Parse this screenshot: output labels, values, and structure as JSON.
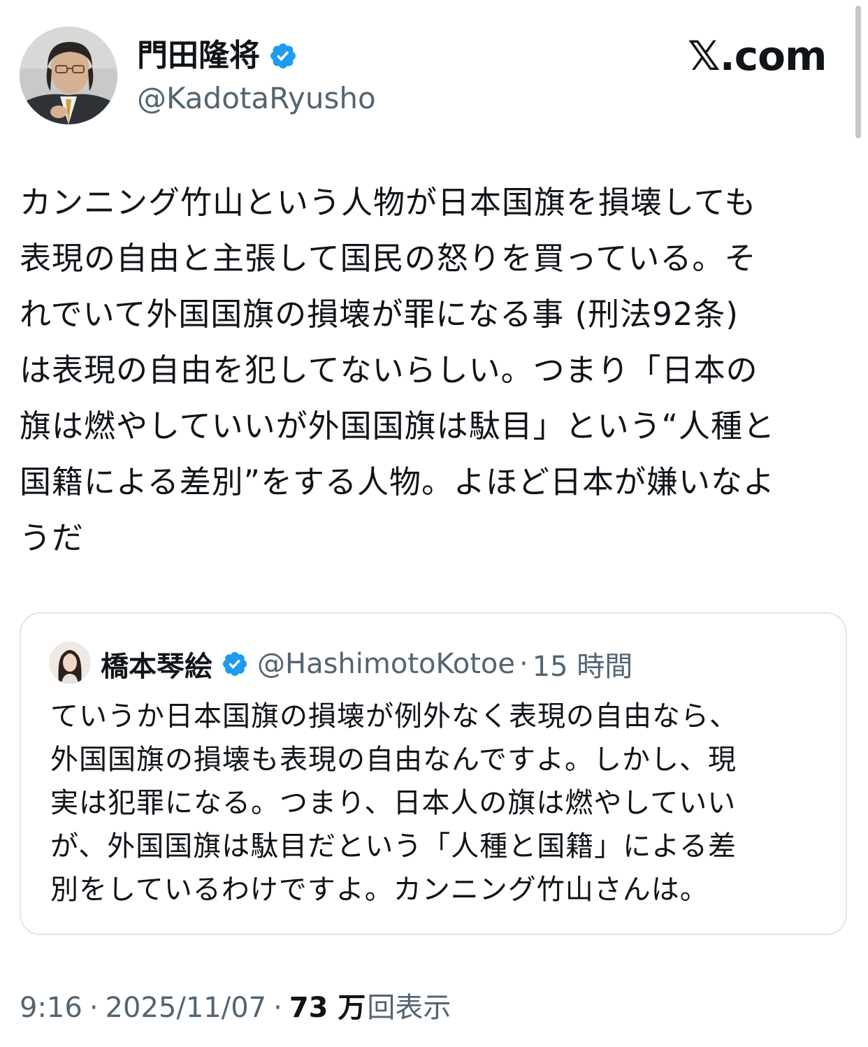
{
  "author": {
    "name": "門田隆将",
    "handle": "@KadotaRyusho"
  },
  "brand": "𝕏.com",
  "tweet": {
    "text": "カンニング竹山という人物が日本国旗を損壊しても\n表現の自由と主張して国民の怒りを買っている。そ\nれでいて外国国旗の損壊が罪になる事 (刑法92条)\nは表現の自由を犯してないらしい。つまり「日本の\n旗は燃やしていいが外国国旗は駄目」という“人種と\n国籍による差別”をする人物。よほど日本が嫌いなよ\nうだ"
  },
  "quoted": {
    "name": "橋本琴絵",
    "handle": "@HashimotoKotoe",
    "separator": "·",
    "time": "15 時間",
    "text": "ていうか日本国旗の損壊が例外なく表現の自由なら、\n外国国旗の損壊も表現の自由なんですよ。しかし、現\n実は犯罪になる。つまり、日本人の旗は燃やしていい\nが、外国国旗は駄目だという「人種と国籍」による差\n別をしているわけですよ。カンニング竹山さんは。"
  },
  "meta": {
    "time": "9:16",
    "separator": "·",
    "date": "2025/11/07",
    "views_count": "73 万",
    "views_label": "回表示"
  },
  "colors": {
    "verified_blue": "#1d9bf0",
    "secondary_text": "#536471",
    "border": "#e1e6ea"
  },
  "icons": {
    "verified": "verified-badge-icon",
    "x_logo": "x-logo"
  }
}
